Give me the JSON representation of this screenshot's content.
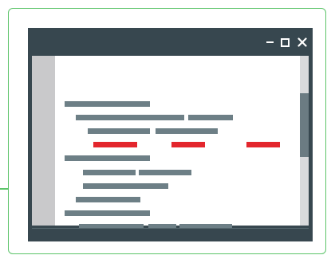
{
  "window": {
    "controls": {
      "minimize_icon": "minimize-icon",
      "maximize_icon": "maximize-icon",
      "close_icon": "close-icon",
      "close_glyph": "✕"
    }
  },
  "colors": {
    "frame": "#5cc469",
    "window_chrome": "#37474f",
    "code_line": "#6d7f86",
    "error_line": "#e3262d",
    "gutter": "#c9c9cb",
    "scroll_track": "#d9dadc",
    "scroll_thumb": "#6b7b82"
  },
  "editor": {
    "line_count": 10,
    "highlighted_error_row": 4,
    "scroll_position": 0.35
  }
}
